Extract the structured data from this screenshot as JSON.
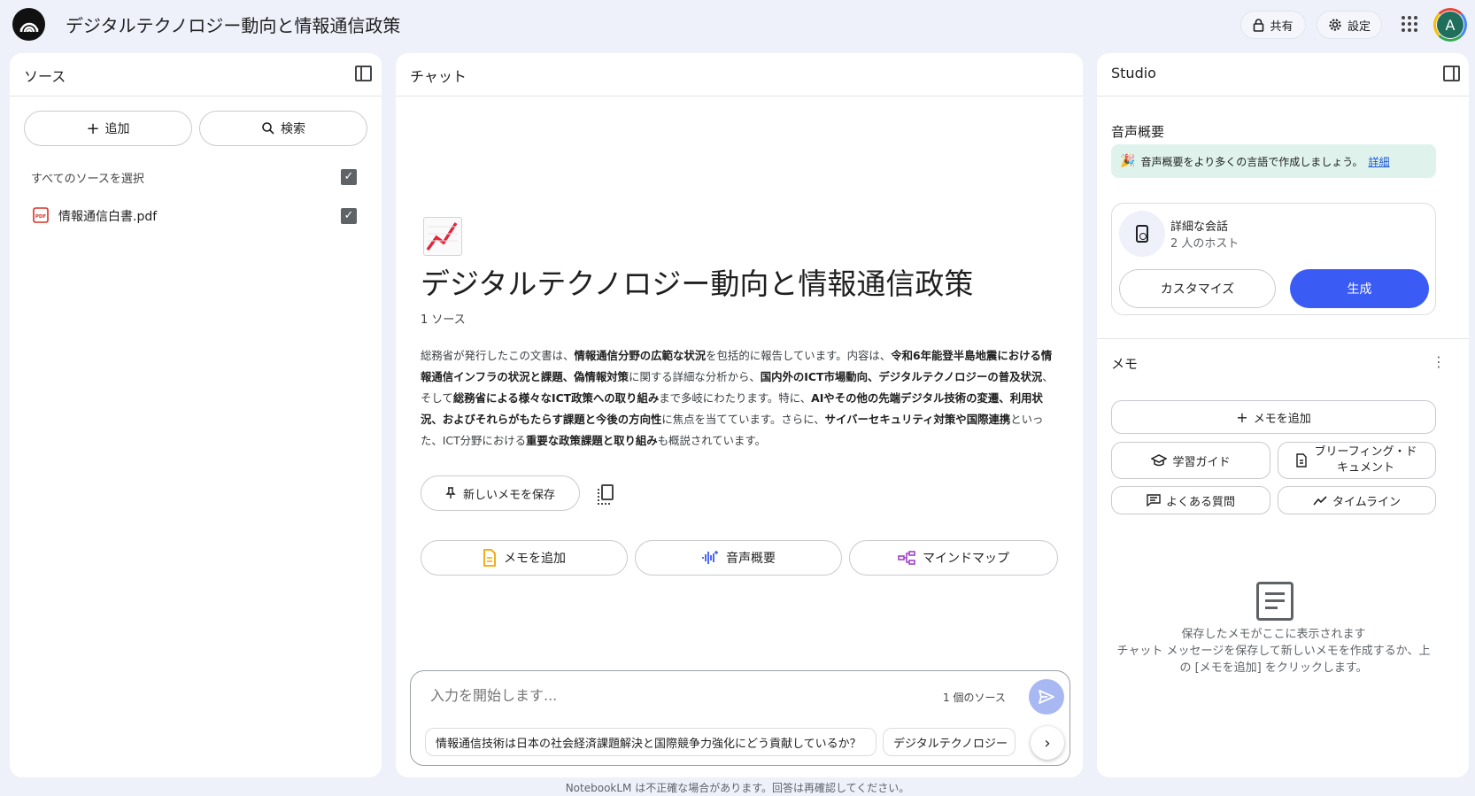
{
  "app": {
    "title": "デジタルテクノロジー動向と情報通信政策"
  },
  "header": {
    "share_label": "共有",
    "settings_label": "設定",
    "avatar_initial": "A"
  },
  "sources": {
    "title": "ソース",
    "add_label": "追加",
    "search_label": "検索",
    "select_all_label": "すべてのソースを選択",
    "items": [
      {
        "name": "情報通信白書.pdf",
        "checked": true
      }
    ]
  },
  "chat": {
    "title": "チャット",
    "notebook_title": "デジタルテクノロジー動向と情報通信政策",
    "source_count": "1 ソース",
    "summary": [
      {
        "t": "総務省が発行したこの文書は、",
        "b": false
      },
      {
        "t": "情報通信分野の広範な状況",
        "b": true
      },
      {
        "t": "を包括的に報告しています。内容は、",
        "b": false
      },
      {
        "t": "令和6年能登半島地震における情報通信インフラの状況と課題、偽情報対策",
        "b": true
      },
      {
        "t": "に関する詳細な分析から、",
        "b": false
      },
      {
        "t": "国内外のICT市場動向、デジタルテクノロジーの普及状況",
        "b": true
      },
      {
        "t": "、そして",
        "b": false
      },
      {
        "t": "総務省による様々なICT政策への取り組み",
        "b": true
      },
      {
        "t": "まで多岐にわたります。特に、",
        "b": false
      },
      {
        "t": "AIやその他の先端デジタル技術の変遷、利用状況、およびそれらがもたらす課題と今後の方向性",
        "b": true
      },
      {
        "t": "に焦点を当てています。さらに、",
        "b": false
      },
      {
        "t": "サイバーセキュリティ対策や国際連携",
        "b": true
      },
      {
        "t": "といった、ICT分野における",
        "b": false
      },
      {
        "t": "重要な政策課題と取り組み",
        "b": true
      },
      {
        "t": "も概説されています。",
        "b": false
      }
    ],
    "save_memo_label": "新しいメモを保存",
    "actions": {
      "add_memo": "メモを追加",
      "audio_overview": "音声概要",
      "mind_map": "マインドマップ"
    },
    "input_placeholder": "入力を開始します...",
    "input_source_count": "1 個のソース",
    "suggestions": [
      "情報通信技術は日本の社会経済課題解決と国際競争力強化にどう貢献しているか？",
      "デジタルテクノロジー"
    ]
  },
  "studio": {
    "title": "Studio",
    "audio_section_title": "音声概要",
    "banner_text": "音声概要をより多くの言語で作成しましょう。",
    "banner_link": "詳細",
    "card_title": "詳細な会話",
    "card_subtitle": "2 人のホスト",
    "customize_label": "カスタマイズ",
    "generate_label": "生成",
    "memo_section_title": "メモ",
    "add_memo_label": "メモを追加",
    "study_guide_label": "学習ガイド",
    "briefing_label": "ブリーフィング・ドキュメント",
    "faq_label": "よくある質問",
    "timeline_label": "タイムライン",
    "empty_title": "保存したメモがここに表示されます",
    "empty_desc": "チャット メッセージを保存して新しいメモを作成するか、上の [メモを追加] をクリックします。"
  },
  "footer": {
    "disclaimer": "NotebookLM は不正確な場合があります。回答は再確認してください。"
  },
  "colors": {
    "accent": "#3b5bf5",
    "background": "#eef1fa",
    "banner": "#dff3ec"
  }
}
